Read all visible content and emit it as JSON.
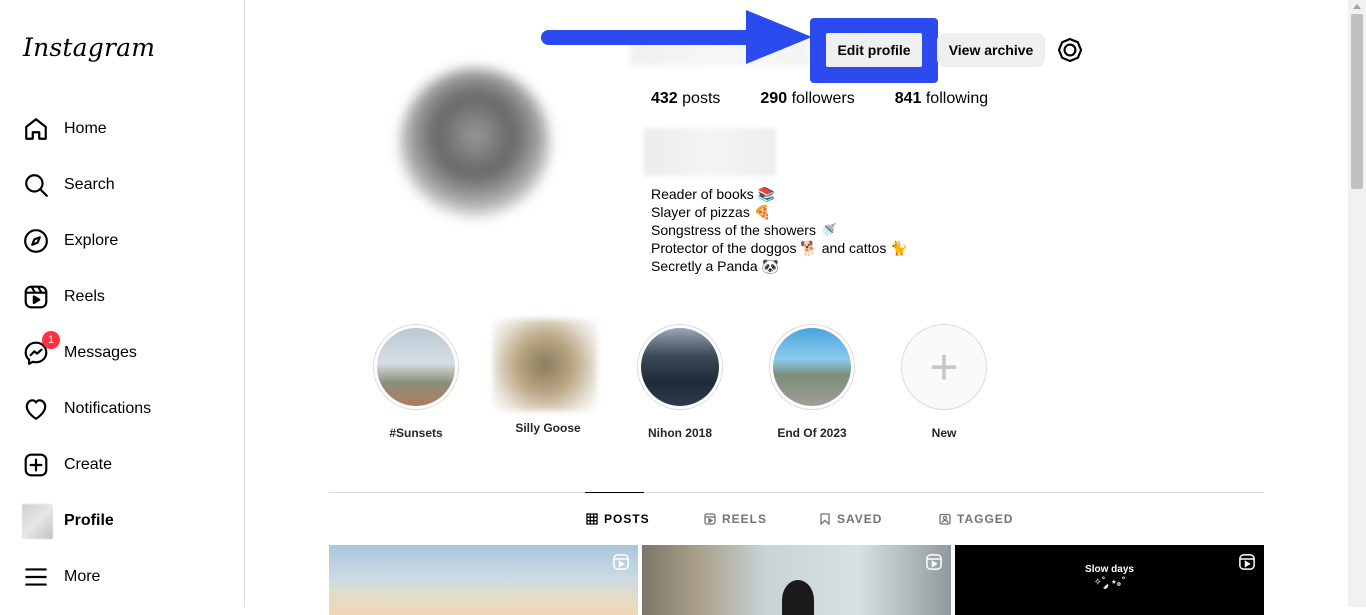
{
  "app": {
    "logo": "Instagram"
  },
  "sidebar": {
    "items": [
      {
        "label": "Home",
        "icon": "home-icon"
      },
      {
        "label": "Search",
        "icon": "search-icon"
      },
      {
        "label": "Explore",
        "icon": "compass-icon"
      },
      {
        "label": "Reels",
        "icon": "reels-icon"
      },
      {
        "label": "Messages",
        "icon": "messenger-icon",
        "badge": "1"
      },
      {
        "label": "Notifications",
        "icon": "heart-icon"
      },
      {
        "label": "Create",
        "icon": "plus-square-icon"
      },
      {
        "label": "Profile",
        "icon": "avatar"
      },
      {
        "label": "More",
        "icon": "menu-icon"
      }
    ]
  },
  "header": {
    "edit_label": "Edit profile",
    "archive_label": "View archive"
  },
  "stats": {
    "posts_count": "432",
    "posts_label": "posts",
    "followers_count": "290",
    "followers_label": "followers",
    "following_count": "841",
    "following_label": "following"
  },
  "bio": {
    "lines": [
      "Reader of books 📚",
      "Slayer of pizzas 🍕",
      "Songstress of the showers 🚿",
      "Protector of the doggos 🐕 and cattos 🐈",
      "Secretly a Panda 🐼"
    ]
  },
  "highlights": [
    {
      "label": "#Sunsets"
    },
    {
      "label": "Silly Goose"
    },
    {
      "label": "Nihon 2018"
    },
    {
      "label": "End Of 2023"
    },
    {
      "label": "New"
    }
  ],
  "tabs": [
    {
      "label": "POSTS"
    },
    {
      "label": "REELS"
    },
    {
      "label": "SAVED"
    },
    {
      "label": "TAGGED"
    }
  ],
  "posts": {
    "third_caption_1": "Slow days",
    "third_caption_2": "✧˚ ༘ ⋆｡˚"
  },
  "colors": {
    "annotation": "#2b4bef",
    "badge": "#ff3040",
    "border": "#dbdbdb"
  }
}
